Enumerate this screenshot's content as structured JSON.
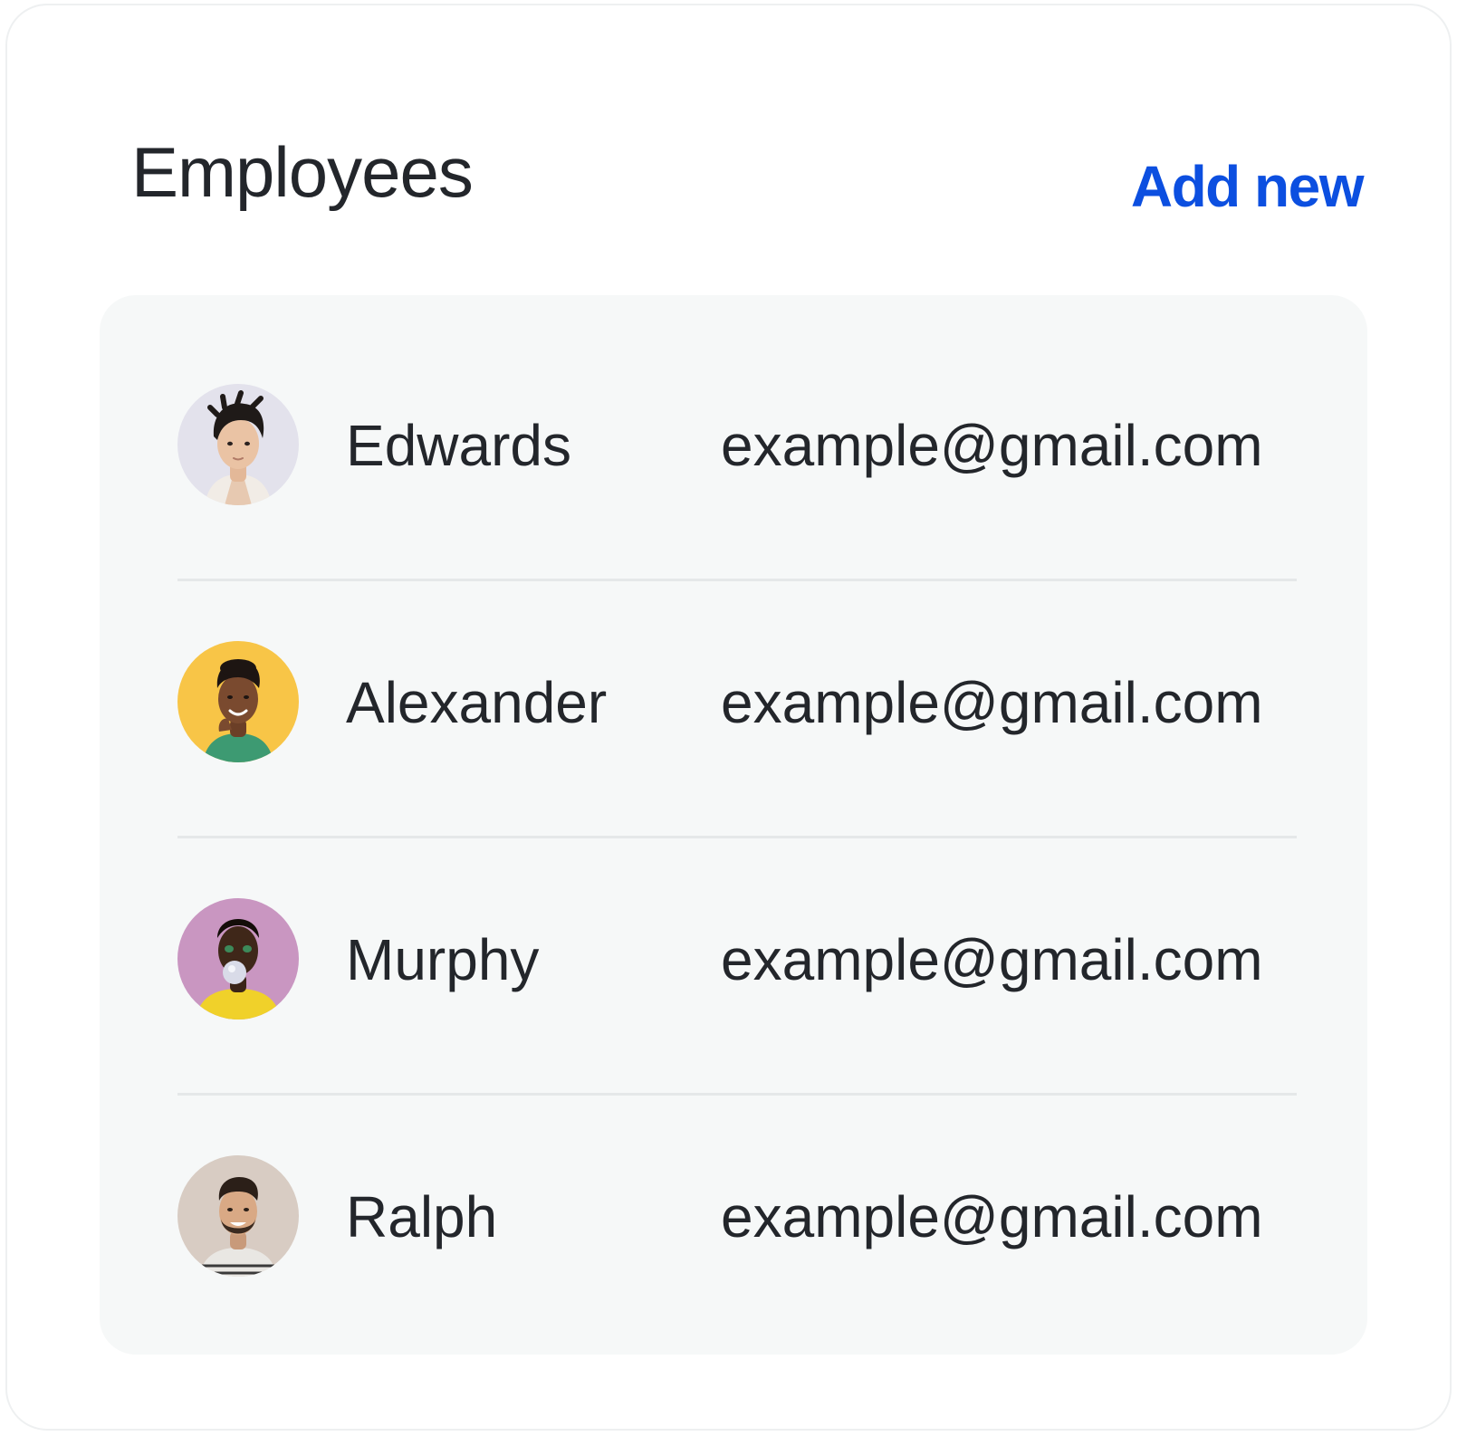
{
  "header": {
    "title": "Employees",
    "add_new_label": "Add new"
  },
  "colors": {
    "accent": "#0c4fe0",
    "text": "#23262b",
    "panel_bg": "#f6f8f8",
    "divider": "#e5e8e9"
  },
  "employees": [
    {
      "name": "Edwards",
      "email": "example@gmail.com",
      "avatar_icon": "avatar-photo-icon",
      "avatar_bg": "#e3e2ec"
    },
    {
      "name": "Alexander",
      "email": "example@gmail.com",
      "avatar_icon": "avatar-photo-icon",
      "avatar_bg": "#f8c547"
    },
    {
      "name": "Murphy",
      "email": "example@gmail.com",
      "avatar_icon": "avatar-photo-icon",
      "avatar_bg": "#c996c1"
    },
    {
      "name": "Ralph",
      "email": "example@gmail.com",
      "avatar_icon": "avatar-photo-icon",
      "avatar_bg": "#d8ccc3"
    }
  ]
}
